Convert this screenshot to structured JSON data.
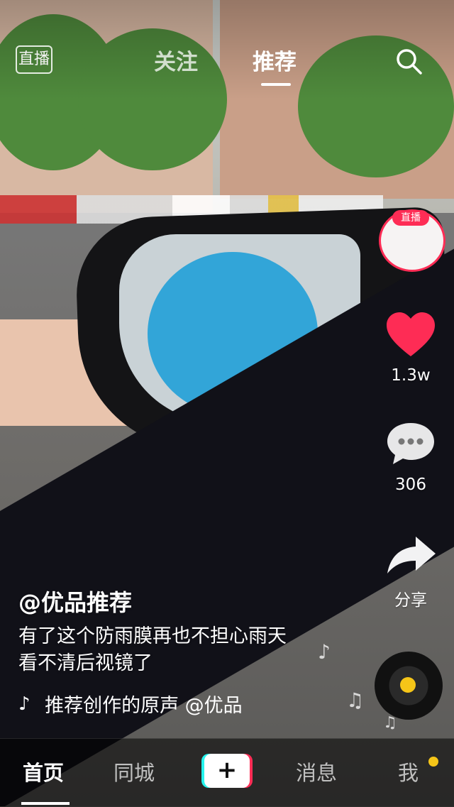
{
  "top_nav": {
    "live_label": "直播",
    "tabs": [
      {
        "label": "关注",
        "active": false
      },
      {
        "label": "推荐",
        "active": true
      }
    ],
    "search_icon": "search-icon"
  },
  "sidebar": {
    "avatar_live_badge": "直播",
    "like_count": "1.3w",
    "comment_count": "306",
    "share_label": "分享",
    "icons": [
      "heart-icon",
      "comment-icon",
      "share-icon",
      "music-disc-icon"
    ]
  },
  "caption": {
    "author": "@优品推荐",
    "description_line1": "有了这个防雨膜再也不担心雨天",
    "description_line2": "看不清后视镜了",
    "music": "推荐创作的原声    @优品"
  },
  "bottom_nav": {
    "items": [
      "首页",
      "同城",
      "消息",
      "我"
    ],
    "active": "首页",
    "create_label": "+",
    "me_has_notification": true
  },
  "colors": {
    "accent_pink": "#fe2c55",
    "accent_cyan": "#25f4ee",
    "notification_yellow": "#f5c518"
  }
}
